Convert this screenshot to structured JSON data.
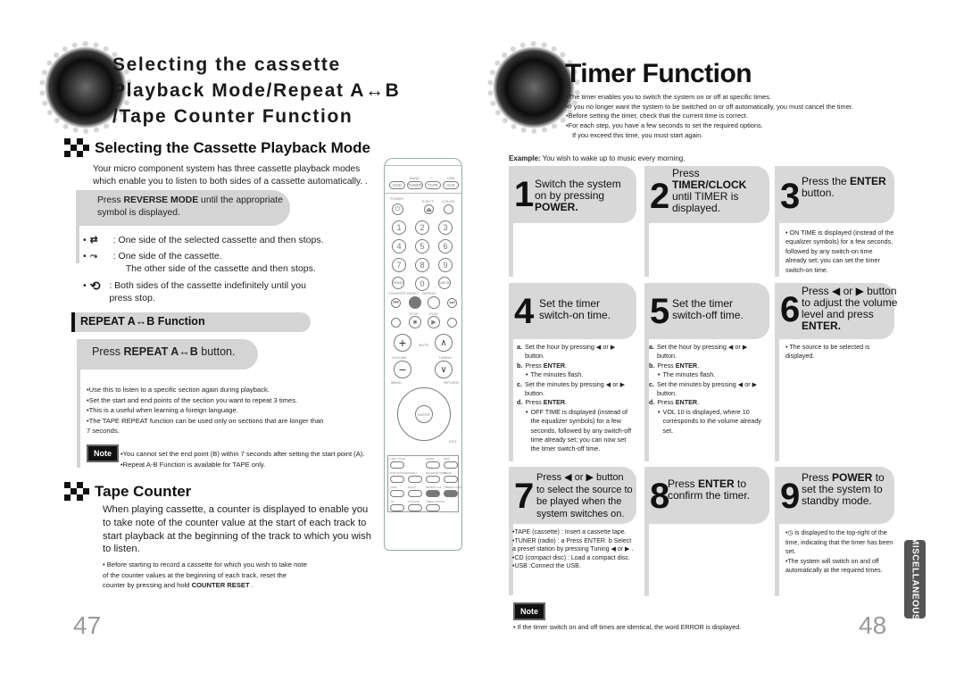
{
  "left_page": {
    "title": "Selecting the cassette Playback Mode/Repeat A↔B /Tape Counter Function",
    "section1": {
      "heading": "Selecting the Cassette Playback Mode",
      "intro": "Your micro component system has three cassette playback modes which enable you to listen to both sides of a cassette automatically. .",
      "instruction_pre": "Press ",
      "instruction_bold": "REVERSE MODE",
      "instruction_post": " until the appropriate symbol is displayed.",
      "modes": [
        {
          "icon": "one-side-icon",
          "glyph": "⇄",
          "text": ": One side of the selected cassette and then stops."
        },
        {
          "icon": "one-way-reverse-icon",
          "glyph": "⤳",
          "text": ": One side of the cassette.",
          "text2": "The other side of the cassette and then stops."
        },
        {
          "icon": "endless-reverse-icon",
          "glyph": "⟲",
          "text": ": Both sides of the cassette indefinitely until you press stop."
        }
      ]
    },
    "section2": {
      "heading": "REPEAT A↔B Function",
      "instruction_pre": "Press ",
      "instruction_bold": "REPEAT A↔B",
      "instruction_post": " button.",
      "bullets": [
        "Use this to listen to a specific section again during playback.",
        "Set the start and end points of the section you want to repeat 3 times.",
        "This is a useful when learning a foreign language.",
        "The TAPE REPEAT function can be used only on sections that are longer than 7 seconds."
      ],
      "note_label": "Note",
      "notes": [
        "You cannot set the end point (B) within 7 seconds after setting the start point (A).",
        "Repeat A-B Function is available for TAPE only."
      ]
    },
    "section3": {
      "heading": "Tape Counter",
      "body": "When playing cassette, a counter is displayed to enable you to take note of the counter value at the start of each track to start playback at the beginning of the track to which you wish to listen.",
      "bullet_pre": "Before starting to record a cassette for which you wish to take note of the counter values at the beginning of each track, reset the counter by pressing and hold ",
      "bullet_bold": "COUNTER RESET",
      "bullet_post": " ."
    },
    "page_number": "47"
  },
  "remote": {
    "source_labels": [
      "BAND",
      "↔",
      "USB"
    ],
    "source_buttons": [
      "DVD",
      "TUNER",
      "TAPE",
      "AUX"
    ],
    "top_labels": [
      "POWER",
      "EJECT",
      "COLOR"
    ],
    "numbers": [
      "1",
      "2",
      "3",
      "4",
      "5",
      "6",
      "7",
      "8",
      "9",
      "REMAIN",
      "0",
      "CANCEL"
    ],
    "transport_labels": [
      "COUNTER RESET",
      "REPEAT",
      "STOP",
      "PLAY"
    ],
    "volume_labels": [
      "VOLUME",
      "MUTE",
      "TUNING"
    ],
    "menu_labels": [
      "MENU",
      "RETURN",
      "ENTER",
      "EXIT"
    ],
    "bottom_labels": [
      "TEST TONE",
      "SLEEP",
      "INFO",
      "SUB WOOFER",
      "CHEST",
      "REVERSE MODE",
      "SLOW",
      "TAPE",
      "ECHO",
      "REPEAT A-B",
      "TIMER/CLOCK",
      "CD",
      "P.SOUND",
      "TIMER ON/OFF"
    ]
  },
  "right_page": {
    "title": "Timer Function",
    "intro_bullets": [
      "The timer enables you to switch the system on or off at specific times.",
      "If you no longer want the system to be switched on or off automatically, you must cancel the timer.",
      "Before setting the timer, check that the current time is correct.",
      "For each step, you have a few seconds to set the required options."
    ],
    "intro_continuation": "If you exceed this time, you must start again.",
    "example_label": "Example:",
    "example_text": " You wish to wake up to music every morning.",
    "steps": [
      {
        "num": "1",
        "lines": [
          "Switch the system",
          "on by pressing"
        ],
        "bold_line": "POWER."
      },
      {
        "num": "2",
        "lines_pre": [
          "Press"
        ],
        "bold_line": "TIMER/CLOCK",
        "lines_post": [
          "until TIMER is",
          "displayed."
        ]
      },
      {
        "num": "3",
        "pre": "Press the ",
        "bold": "ENTER",
        "post": " button.",
        "note": "ON TIME is displayed (instead of the equalizer symbols) for a few seconds, followed by any switch-on time already set; you can set the timer switch-on time."
      },
      {
        "num": "4",
        "lines": [
          "Set the timer",
          "switch-on time."
        ],
        "sub": [
          {
            "k": "a.",
            "t": "Set the hour by pressing ◀ or ▶ button."
          },
          {
            "k": "b.",
            "t": "Press ",
            "b": "ENTER",
            "after": "."
          },
          {
            "k": "•",
            "t": "The minutes flash.",
            "indent": true
          },
          {
            "k": "c.",
            "t": "Set the minutes by pressing ◀ or ▶ button."
          },
          {
            "k": "d.",
            "t": "Press ",
            "b": "ENTER",
            "after": "."
          },
          {
            "k": "•",
            "t": "OFF TIME is displayed (instead of the equalizer symbols) for a few seconds, followed by any switch-off time already set; you can now set the timer switch-off time.",
            "indent": true
          }
        ]
      },
      {
        "num": "5",
        "lines": [
          "Set the timer",
          "switch-off time."
        ],
        "sub": [
          {
            "k": "a.",
            "t": "Set the hour by pressing ◀  or ▶ button."
          },
          {
            "k": "b.",
            "t": "Press ",
            "b": "ENTER",
            "after": "."
          },
          {
            "k": "•",
            "t": "The minutes flash.",
            "indent": true
          },
          {
            "k": "c.",
            "t": "Set the minutes by pressing ◀ or ▶ button."
          },
          {
            "k": "d.",
            "t": "Press ",
            "b": "ENTER",
            "after": "."
          },
          {
            "k": "•",
            "t": "VOL 10 is displayed, where 10 corresponds to the volume already set.",
            "indent": true
          }
        ]
      },
      {
        "num": "6",
        "lines": [
          "Press ◀ or ▶ button",
          "to adjust the volume",
          "level and press"
        ],
        "bold_line": "ENTER.",
        "note": "The source to be selected is displayed."
      },
      {
        "num": "7",
        "lines": [
          "Press ◀ or ▶ button",
          "to select the source to",
          "be played when the",
          "system switches on."
        ],
        "sources": [
          "TAPE (cassette) : Insert a cassette tape.",
          "TUNER (radio) : a Press ENTER.  b Select a preset station by pressing Tuning ◀ or ▶ .",
          "CD (compact disc) : Load a compact disc.",
          "USB   :Connect the USB."
        ]
      },
      {
        "num": "8",
        "pre": "Press ",
        "bold": "ENTER",
        "post": " to confirm the timer."
      },
      {
        "num": "9",
        "pre": "Press ",
        "bold": "POWER",
        "post": " to set the system to standby mode.",
        "notes": [
          "◷ is displayed to the top-right of the time, indicating that the timer has been set.",
          "The system will switch on and off automatically at the required times."
        ]
      }
    ],
    "note_label": "Note",
    "note_text": "If the timer switch on and off times are identical, the word ERROR is displayed.",
    "side_tab": "MISCELLANEOUS",
    "page_number": "48"
  }
}
